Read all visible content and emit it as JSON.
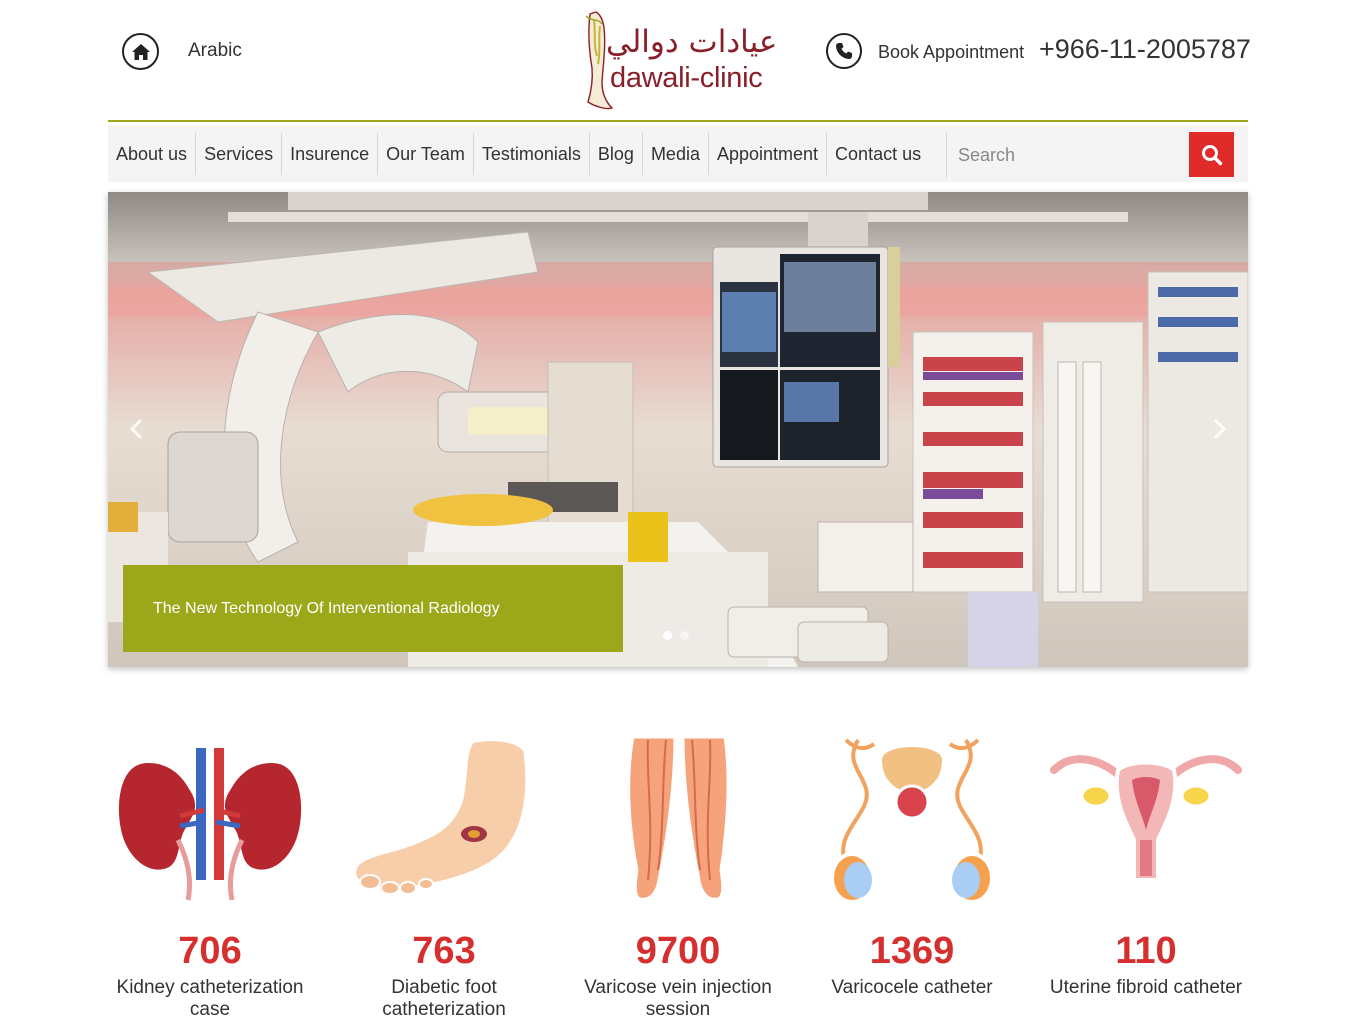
{
  "header": {
    "language_link": "Arabic",
    "logo": {
      "arabic": "عيادات دوالي",
      "english": "dawali-clinic"
    },
    "book_label": "Book Appointment",
    "phone": "+966-11-2005787"
  },
  "nav": {
    "items": [
      {
        "label": "About us"
      },
      {
        "label": "Services"
      },
      {
        "label": "Insurence"
      },
      {
        "label": "Our Team"
      },
      {
        "label": "Testimonials"
      },
      {
        "label": "Blog"
      },
      {
        "label": "Media"
      },
      {
        "label": "Appointment"
      },
      {
        "label": "Contact us"
      }
    ],
    "search_placeholder": "Search"
  },
  "hero": {
    "caption": "The New Technology Of Interventional Radiology",
    "slide_count": 2,
    "active_slide": 1
  },
  "stats": [
    {
      "number": "706",
      "label": "Kidney catheterization case",
      "icon": "kidney-icon"
    },
    {
      "number": "763",
      "label": "Diabetic foot catheterization",
      "icon": "foot-icon"
    },
    {
      "number": "9700",
      "label": "Varicose vein injection session",
      "icon": "legs-icon"
    },
    {
      "number": "1369",
      "label": "Varicocele catheter",
      "icon": "male-reproductive-icon"
    },
    {
      "number": "110",
      "label": "Uterine fibroid catheter",
      "icon": "uterus-icon"
    }
  ],
  "colors": {
    "accent_green": "#9ca81a",
    "accent_red": "#e02b2b",
    "stat_red": "#d62f2f",
    "logo_maroon": "#8a1f2a"
  }
}
